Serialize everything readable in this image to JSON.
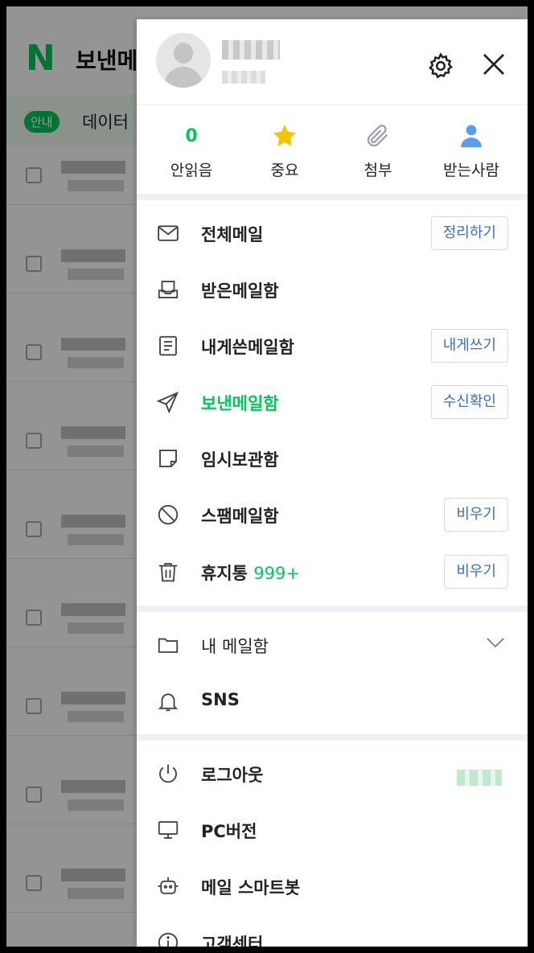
{
  "background": {
    "logo_letter": "N",
    "title": "보낸메",
    "notice_badge": "안내",
    "notice_text": "데이터"
  },
  "quick": [
    {
      "name": "unread",
      "count": "0",
      "label": "안읽음"
    },
    {
      "name": "important",
      "label": "중요",
      "icon": "star-icon"
    },
    {
      "name": "attachment",
      "label": "첨부",
      "icon": "paperclip-icon"
    },
    {
      "name": "recipient",
      "label": "받는사람",
      "icon": "person-icon"
    }
  ],
  "menu": {
    "all_mail": {
      "label": "전체메일",
      "button": "정리하기"
    },
    "inbox": {
      "label": "받은메일함"
    },
    "sent_self": {
      "label": "내게쓴메일함",
      "button": "내게쓰기"
    },
    "sent": {
      "label": "보낸메일함",
      "button": "수신확인"
    },
    "drafts": {
      "label": "임시보관함"
    },
    "spam": {
      "label": "스팸메일함",
      "button": "비우기"
    },
    "trash": {
      "label": "휴지통",
      "badge": "999+",
      "button": "비우기"
    },
    "my_folders": {
      "label": "내 메일함"
    },
    "sns": {
      "label": "SNS"
    },
    "logout": {
      "label": "로그아웃"
    },
    "pc": {
      "label": "PC버전"
    },
    "bot": {
      "label": "메일 스마트봇"
    },
    "help": {
      "label": "고객센터"
    }
  },
  "colors": {
    "accent": "#03c75a",
    "button_text": "#3a6fc4",
    "star": "#f5c400",
    "person": "#5b9bf0"
  }
}
